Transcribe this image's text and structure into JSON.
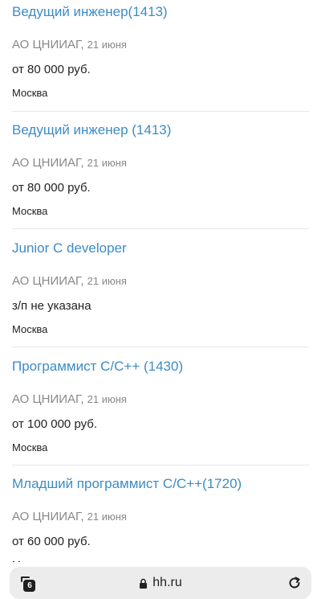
{
  "vacancies": [
    {
      "title": "Ведущий инженер(1413)",
      "company": "АО ЦНИИАГ",
      "date": "21 июня",
      "salary": "от 80 000 руб.",
      "city": "Москва"
    },
    {
      "title": "Ведущий инженер (1413)",
      "company": "АО ЦНИИАГ",
      "date": "21 июня",
      "salary": "от 80 000 руб.",
      "city": "Москва"
    },
    {
      "title": "Junior C developer",
      "company": "АО ЦНИИАГ",
      "date": "21 июня",
      "salary": "з/п не указана",
      "city": "Москва"
    },
    {
      "title": "Программист C/C++ (1430)",
      "company": "АО ЦНИИАГ",
      "date": "21 июня",
      "salary": "от 100 000 руб.",
      "city": "Москва"
    },
    {
      "title": "Младший программист C/C++(1720)",
      "company": "АО ЦНИИАГ",
      "date": "21 июня",
      "salary": "от 60 000 руб.",
      "city": "Москва"
    }
  ],
  "browser": {
    "url": "hh.ru",
    "tab_count": "6",
    "icons": {
      "tabs": "tabs-icon",
      "lock": "lock-icon",
      "reload": "reload-icon"
    }
  }
}
